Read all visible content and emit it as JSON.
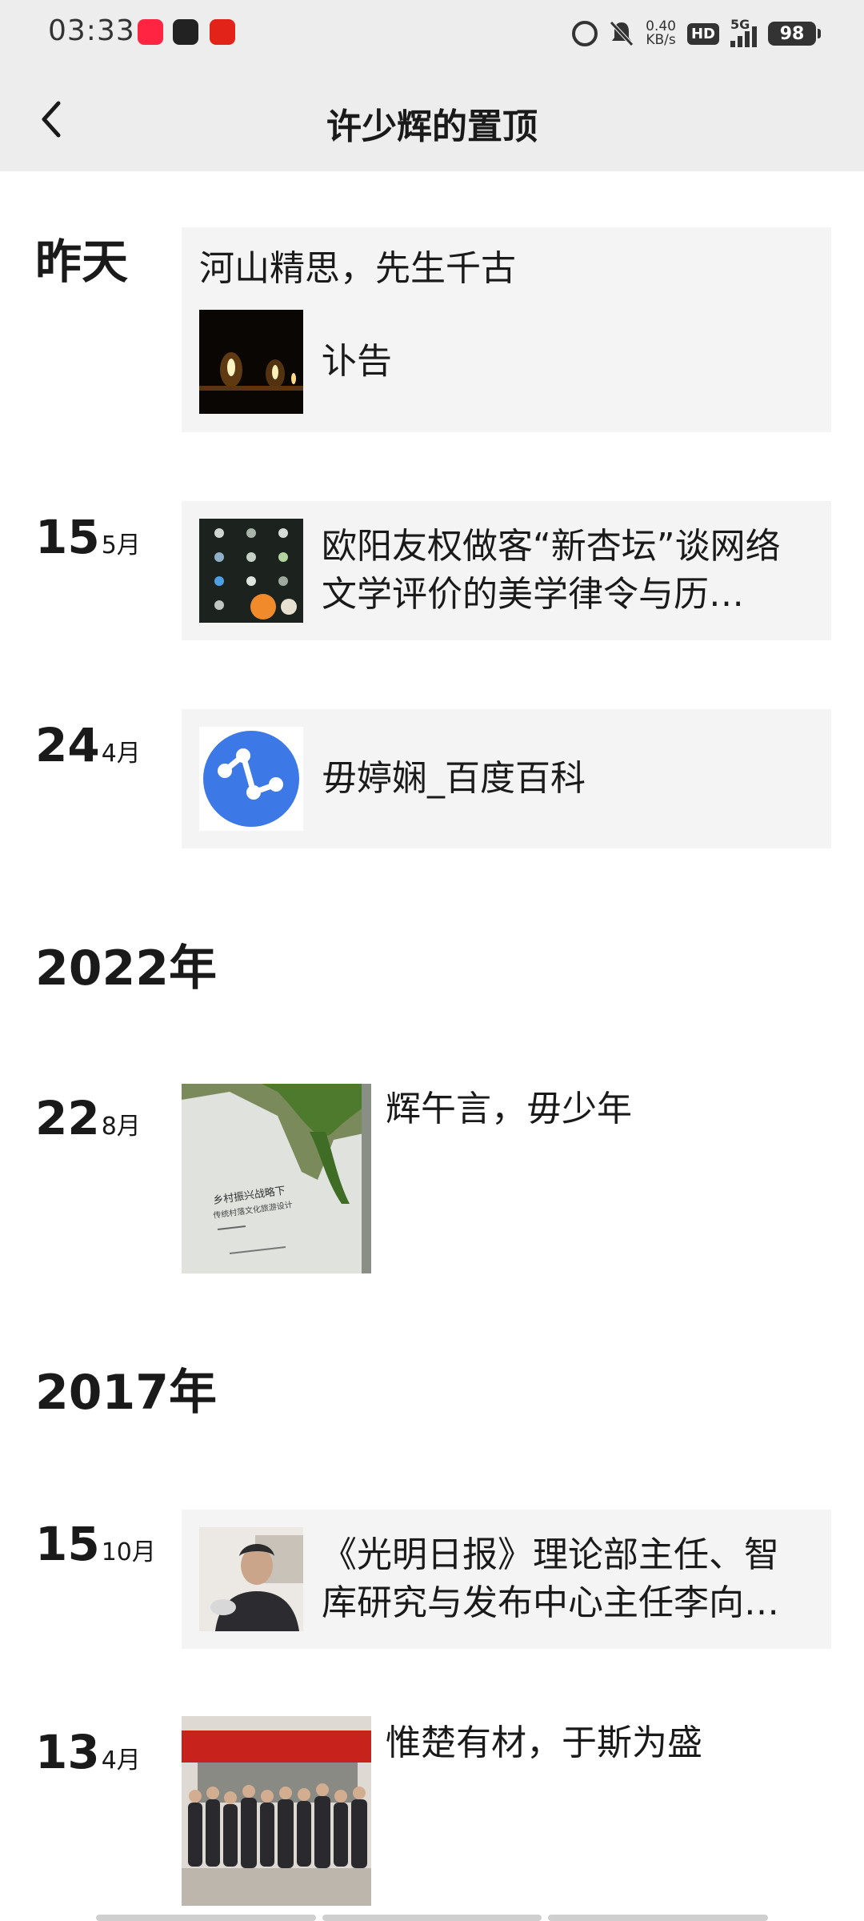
{
  "status_bar": {
    "time": "03:33",
    "net_speed_value": "0.40",
    "net_speed_unit": "KB/s",
    "hd": "HD",
    "signal": "5G",
    "battery": "98"
  },
  "nav": {
    "title": "许少辉的置顶"
  },
  "timeline": {
    "group1": {
      "date_label": "昨天",
      "title": "河山精思，先生千古",
      "subtitle": "讣告"
    },
    "entry2": {
      "day": "15",
      "month": "5月",
      "title": "欧阳友权做客“新杏坛”谈网络文学评价的美学律令与历…"
    },
    "entry3": {
      "day": "24",
      "month": "4月",
      "title": "毋婷娴_百度百科"
    },
    "year_2022": "2022年",
    "entry4": {
      "day": "22",
      "month": "8月",
      "caption": "辉午言，毋少年",
      "book_title": "乡村振兴战略下",
      "book_subtitle": "传统村落文化旅游设计"
    },
    "year_2017": "2017年",
    "entry5": {
      "day": "15",
      "month": "10月",
      "title": "《光明日报》理论部主任、智库研究与发布中心主任李向…"
    },
    "entry6": {
      "day": "13",
      "month": "4月",
      "caption": "惟楚有材，于斯为盛"
    }
  },
  "colors": {
    "header_bg": "#ededed",
    "card_bg": "#f4f4f4",
    "text": "#1a1a1a",
    "baidu_blue": "#3c78e6"
  }
}
